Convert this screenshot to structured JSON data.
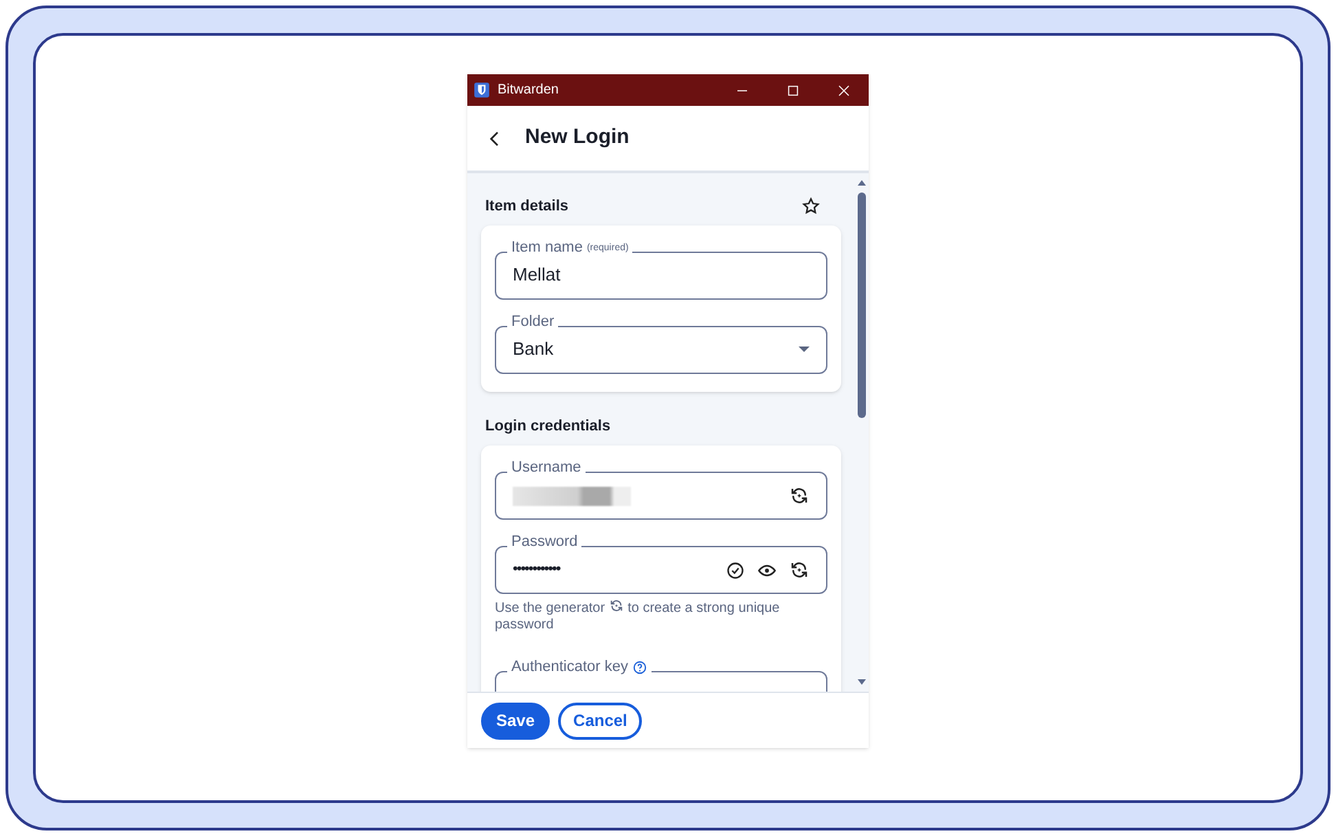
{
  "window": {
    "title": "Bitwarden"
  },
  "header": {
    "title": "New Login"
  },
  "item_details": {
    "heading": "Item details",
    "favorite": false,
    "name_field": {
      "label": "Item name",
      "hint": "(required)",
      "value": "Mellat"
    },
    "folder_field": {
      "label": "Folder",
      "value": "Bank"
    }
  },
  "login_credentials": {
    "heading": "Login credentials",
    "username_field": {
      "label": "Username",
      "redacted": true
    },
    "password_field": {
      "label": "Password",
      "value": "••••••••••••"
    },
    "generator_hint": [
      "Use the generator",
      "to create a strong unique password"
    ],
    "authenticator_field": {
      "label": "Authenticator key"
    }
  },
  "buttons": [
    {
      "label": "Save",
      "kind": "primary"
    },
    {
      "label": "Cancel",
      "kind": "secondary"
    }
  ]
}
